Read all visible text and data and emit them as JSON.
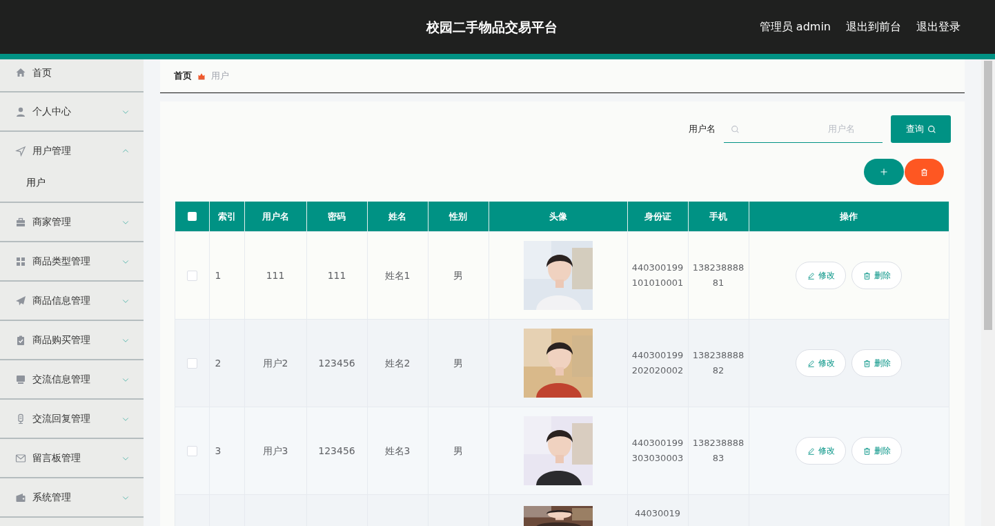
{
  "header": {
    "title": "校园二手物品交易平台",
    "user_label": "管理员 admin",
    "links": [
      "退出到前台",
      "退出登录"
    ]
  },
  "sidebar": {
    "items": [
      {
        "label": "首页",
        "kind": "link"
      },
      {
        "label": "个人中心",
        "kind": "menu",
        "expanded": false
      },
      {
        "label": "用户管理",
        "kind": "menu",
        "expanded": true,
        "children": [
          {
            "label": "用户"
          }
        ]
      },
      {
        "label": "商家管理",
        "kind": "menu",
        "expanded": false
      },
      {
        "label": "商品类型管理",
        "kind": "menu",
        "expanded": false
      },
      {
        "label": "商品信息管理",
        "kind": "menu",
        "expanded": false
      },
      {
        "label": "商品购买管理",
        "kind": "menu",
        "expanded": false
      },
      {
        "label": "交流信息管理",
        "kind": "menu",
        "expanded": false
      },
      {
        "label": "交流回复管理",
        "kind": "menu",
        "expanded": false
      },
      {
        "label": "留言板管理",
        "kind": "menu",
        "expanded": false
      },
      {
        "label": "系统管理",
        "kind": "menu",
        "expanded": false
      }
    ]
  },
  "breadcrumb": [
    "首页",
    "用户"
  ],
  "search": {
    "label": "用户名",
    "placeholder": "用户名",
    "button": "查询"
  },
  "table": {
    "select_all": {
      "checked": false
    },
    "columns": [
      "索引",
      "用户名",
      "密码",
      "姓名",
      "性别",
      "头像",
      "身份证",
      "手机",
      "操作"
    ],
    "rows": [
      {
        "checked": false,
        "index": "1",
        "username": "111",
        "password": "111",
        "name": "姓名1",
        "gender": "男",
        "id_card": "440300199101010001",
        "phone": "13823888881",
        "actions": [
          "修改",
          "删除"
        ]
      },
      {
        "checked": false,
        "index": "2",
        "username": "用户2",
        "password": "123456",
        "name": "姓名2",
        "gender": "男",
        "id_card": "440300199202020002",
        "phone": "13823888882",
        "actions": [
          "修改",
          "删除"
        ]
      },
      {
        "checked": false,
        "index": "3",
        "username": "用户3",
        "password": "123456",
        "name": "姓名3",
        "gender": "男",
        "id_card": "440300199303030003",
        "phone": "13823888883",
        "actions": [
          "修改",
          "删除"
        ]
      },
      {
        "id_card": "44030019"
      }
    ]
  }
}
